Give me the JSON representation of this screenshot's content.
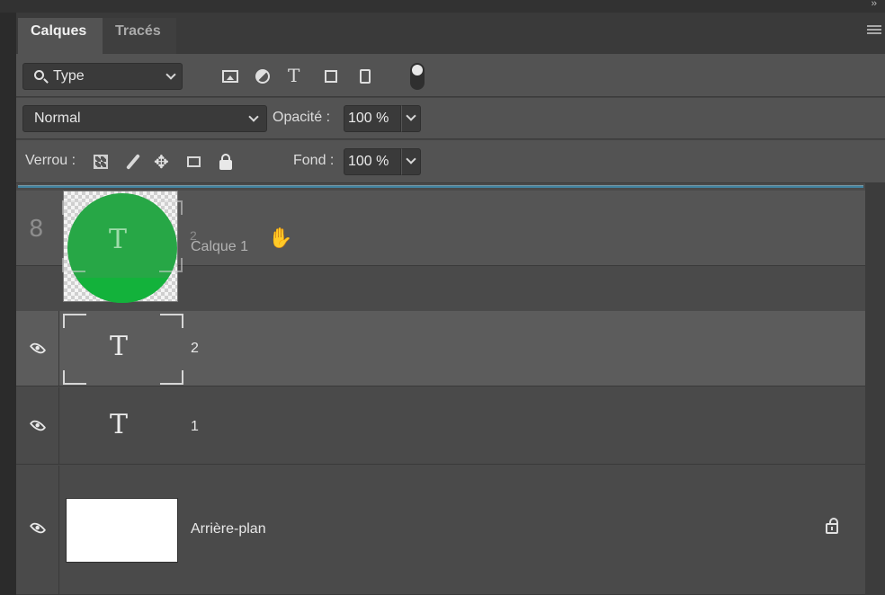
{
  "panel": {
    "tabs": [
      {
        "label": "Calques",
        "active": true
      },
      {
        "label": "Tracés",
        "active": false
      }
    ],
    "collapse_glyph": "››",
    "menu_icon": "hamburger-icon"
  },
  "filter": {
    "kind_label": "Type",
    "icons": [
      "pixel-layer-filter-icon",
      "adjustment-layer-filter-icon",
      "type-layer-filter-icon",
      "shape-layer-filter-icon",
      "smart-object-filter-icon"
    ]
  },
  "blend": {
    "mode": "Normal",
    "opacity_label": "Opacité :",
    "opacity_value": "100 %"
  },
  "lock": {
    "label": "Verrou :",
    "fill_label": "Fond :",
    "fill_value": "100 %"
  },
  "drag": {
    "ghost_name": "Calque 1",
    "target_label": "2",
    "thumb_glyph": "T",
    "thumb_color": "#27a746"
  },
  "layers": [
    {
      "name": "2",
      "glyph": "T",
      "visible": true,
      "selected": true
    },
    {
      "name": "1",
      "glyph": "T",
      "visible": true,
      "selected": false
    },
    {
      "name": "Arrière-plan",
      "visible": true,
      "locked": true
    }
  ],
  "colors": {
    "panel_bg": "#444444",
    "selected_row": "#5c5c5c",
    "drop_indicator": "#3db5e8"
  }
}
